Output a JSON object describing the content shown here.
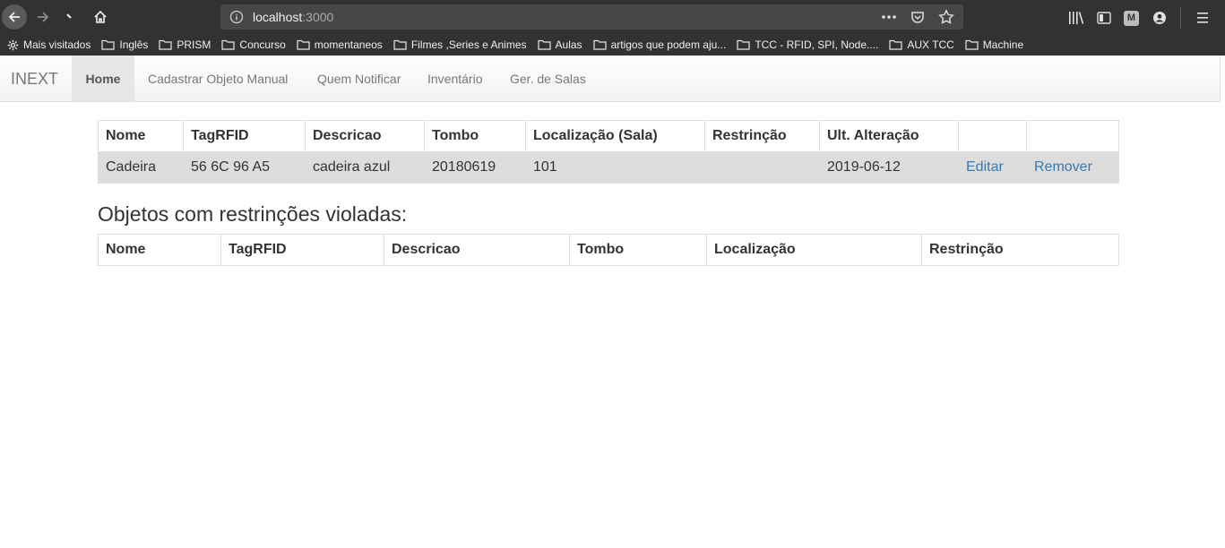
{
  "browser": {
    "url_host": "localhost",
    "url_port": ":3000",
    "bookmarks": [
      {
        "label": "Mais visitados",
        "icon": "gear-icon"
      },
      {
        "label": "Inglês",
        "icon": "folder-icon"
      },
      {
        "label": "PRISM",
        "icon": "folder-icon"
      },
      {
        "label": "Concurso",
        "icon": "folder-icon"
      },
      {
        "label": "momentaneos",
        "icon": "folder-icon"
      },
      {
        "label": "Filmes ,Series e Animes",
        "icon": "folder-icon"
      },
      {
        "label": "Aulas",
        "icon": "folder-icon"
      },
      {
        "label": "artigos que podem aju...",
        "icon": "folder-icon"
      },
      {
        "label": "TCC - RFID, SPI, Node....",
        "icon": "folder-icon"
      },
      {
        "label": "AUX TCC",
        "icon": "folder-icon"
      },
      {
        "label": "Machine",
        "icon": "folder-icon"
      }
    ],
    "account_badge": "M"
  },
  "navbar": {
    "brand": "INEXT",
    "items": [
      {
        "label": "Home",
        "active": true
      },
      {
        "label": "Cadastrar Objeto Manual",
        "active": false
      },
      {
        "label": "Quem Notificar",
        "active": false
      },
      {
        "label": "Inventário",
        "active": false
      },
      {
        "label": "Ger. de Salas",
        "active": false
      }
    ]
  },
  "objects_table": {
    "headers": [
      "Nome",
      "TagRFID",
      "Descricao",
      "Tombo",
      "Localização (Sala)",
      "Restrinção",
      "Ult. Alteração",
      "",
      ""
    ],
    "rows": [
      {
        "nome": "Cadeira",
        "tag": "56 6C 96 A5",
        "descricao": "cadeira azul",
        "tombo": "20180619",
        "localizacao": "101",
        "restricao": "",
        "ult_alteracao": "2019-06-12",
        "edit_label": "Editar",
        "remove_label": "Remover"
      }
    ]
  },
  "violations": {
    "title": "Objetos com restrinções violadas:",
    "headers": [
      "Nome",
      "TagRFID",
      "Descricao",
      "Tombo",
      "Localização",
      "Restrinção"
    ]
  },
  "colors": {
    "link": "#337ab7",
    "row_highlight": "#dddddd",
    "chrome": "#323234"
  }
}
